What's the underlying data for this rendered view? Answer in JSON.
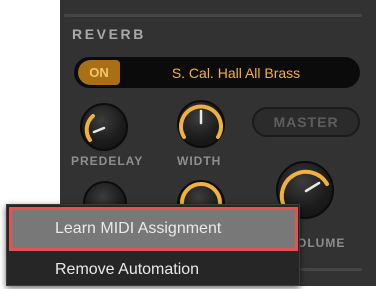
{
  "section": {
    "title": "REVERB"
  },
  "preset": {
    "on_label": "ON",
    "name": "S. Cal. Hall All Brass"
  },
  "knobs": [
    {
      "label": "PREDELAY",
      "level": 0.25
    },
    {
      "label": "WIDTH",
      "level": 0.5
    },
    {
      "label": "VOLUME",
      "level": 0.75
    }
  ],
  "master_label": "MASTER",
  "context_menu": {
    "items": [
      {
        "label": "Learn MIDI Assignment",
        "highlighted": true
      },
      {
        "label": "Remove Automation",
        "highlighted": false
      }
    ]
  },
  "colors": {
    "accent": "#f0b23d",
    "toggle_bg": "#a86f15",
    "highlight_outline": "#e05553"
  },
  "icons": {
    "knob": "rotary-knob-icon"
  }
}
